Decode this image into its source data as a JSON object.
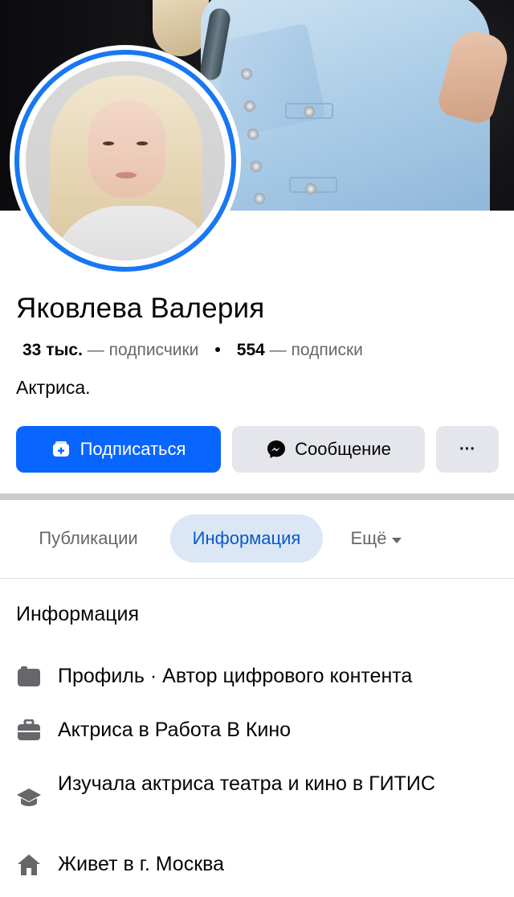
{
  "profile": {
    "name": "Яковлева Валерия",
    "followers_count": "33 тыс.",
    "followers_label": "— подписчики",
    "following_count": "554",
    "following_label": "— подписки",
    "bio": "Актриса."
  },
  "actions": {
    "follow_label": "Подписаться",
    "message_label": "Сообщение",
    "more_label": "···"
  },
  "tabs": {
    "posts": "Публикации",
    "info": "Информация",
    "more": "Ещё"
  },
  "info_section": {
    "title": "Информация",
    "items": [
      {
        "icon": "profile-icon",
        "text": "Профиль · Автор цифрового контента"
      },
      {
        "icon": "briefcase-icon",
        "text": "Актриса в Работа В Кино"
      },
      {
        "icon": "graduation-cap-icon",
        "text": "Изучала актриса театра и кино в ГИТИС"
      },
      {
        "icon": "home-icon",
        "text": "Живет в г. Москва"
      }
    ]
  },
  "colors": {
    "accent": "#0866ff",
    "avatar_ring": "#1877f2",
    "secondary_button": "#e4e6eb",
    "active_tab_bg": "#dbe7f5",
    "active_tab_text": "#0a58ca",
    "muted_text": "#65676b"
  }
}
